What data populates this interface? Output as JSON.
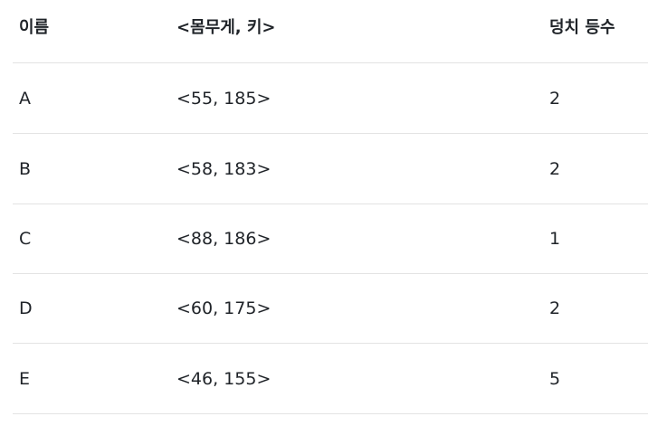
{
  "table": {
    "headers": {
      "name": "이름",
      "weight_height": "<몸무게, 키>",
      "rank": "덩치 등수"
    },
    "rows": [
      {
        "name": "A",
        "weight_height": "<55, 185>",
        "rank": "2"
      },
      {
        "name": "B",
        "weight_height": "<58, 183>",
        "rank": "2"
      },
      {
        "name": "C",
        "weight_height": "<88, 186>",
        "rank": "1"
      },
      {
        "name": "D",
        "weight_height": "<60, 175>",
        "rank": "2"
      },
      {
        "name": "E",
        "weight_height": "<46, 155>",
        "rank": "5"
      }
    ]
  }
}
